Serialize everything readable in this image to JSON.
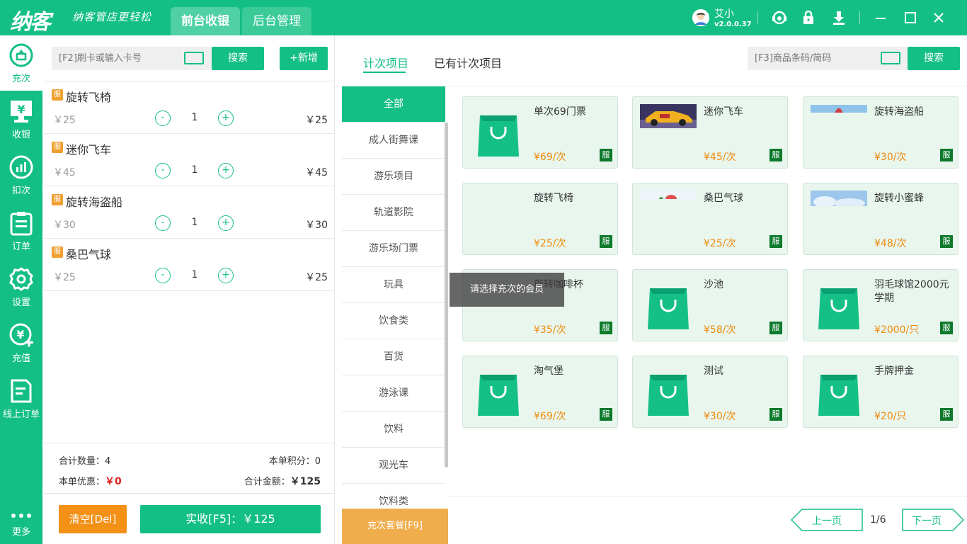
{
  "header": {
    "logo": "纳客",
    "slogan": "纳客管店更轻松",
    "tabs": [
      {
        "label": "前台收银"
      },
      {
        "label": "后台管理"
      }
    ],
    "user_name": "艾小",
    "version": "v2.0.0.37"
  },
  "sidebar": {
    "items": [
      {
        "label": "充次",
        "icon": "recharge-count-icon"
      },
      {
        "label": "收银",
        "icon": "cashier-icon"
      },
      {
        "label": "扣次",
        "icon": "deduct-icon"
      },
      {
        "label": "订单",
        "icon": "order-icon"
      },
      {
        "label": "设置",
        "icon": "gear-icon"
      },
      {
        "label": "充值",
        "icon": "topup-icon"
      },
      {
        "label": "线上订单",
        "icon": "online-order-icon"
      },
      {
        "label": "更多",
        "icon": "more-icon"
      }
    ]
  },
  "left": {
    "card_placeholder": "[F2]刷卡或输入卡号",
    "search_label": "搜索",
    "add_label": "+新增",
    "cart": [
      {
        "badge": "服",
        "name": "旋转飞椅",
        "price": "￥25",
        "qty": "1",
        "total": "￥25"
      },
      {
        "badge": "服",
        "name": "迷你飞车",
        "price": "￥45",
        "qty": "1",
        "total": "￥45"
      },
      {
        "badge": "服",
        "name": "旋转海盗船",
        "price": "￥30",
        "qty": "1",
        "total": "￥30"
      },
      {
        "badge": "服",
        "name": "桑巴气球",
        "price": "￥25",
        "qty": "1",
        "total": "￥25"
      }
    ],
    "minus": "-",
    "plus": "+",
    "summary": {
      "count_label": "合计数量：4",
      "points_label": "本单积分：0",
      "discount_label": "本单优惠：",
      "discount_value": "￥0",
      "total_label": "合计金额：",
      "total_value": "￥125"
    },
    "clear_label": "清空[Del]",
    "pay_label": "实收[F5]：￥125"
  },
  "right": {
    "tabs": [
      {
        "label": "计次项目"
      },
      {
        "label": "已有计次项目"
      }
    ],
    "barcode_placeholder": "[F3]商品条码/简码",
    "search_label": "搜索",
    "categories": [
      "全部",
      "成人街舞课",
      "游乐项目",
      "轨道影院",
      "游乐场门票",
      "玩具",
      "饮食类",
      "百货",
      "游泳课",
      "饮料",
      "观光车",
      "饮料类"
    ],
    "package_label": "充次套餐[F9]",
    "products": [
      {
        "name": "单次69门票",
        "price": "¥69/次",
        "badge": "服",
        "img": "bag"
      },
      {
        "name": "迷你飞车",
        "price": "¥45/次",
        "badge": "服",
        "img": "car"
      },
      {
        "name": "旋转海盗船",
        "price": "¥30/次",
        "badge": "服",
        "img": "sky-strip"
      },
      {
        "name": "旋转飞椅",
        "price": "¥25/次",
        "badge": "服",
        "img": "none"
      },
      {
        "name": "桑巴气球",
        "price": "¥25/次",
        "badge": "服",
        "img": "balloon-strip"
      },
      {
        "name": "旋转小蜜蜂",
        "price": "¥48/次",
        "badge": "服",
        "img": "cloud"
      },
      {
        "name": "旋转咖啡杯",
        "price": "¥35/次",
        "badge": "服",
        "img": "none"
      },
      {
        "name": "沙池",
        "price": "¥58/次",
        "badge": "服",
        "img": "bag"
      },
      {
        "name": "羽毛球馆2000元学期",
        "price": "¥2000/只",
        "badge": "服",
        "img": "bag"
      },
      {
        "name": "淘气堡",
        "price": "¥69/次",
        "badge": "服",
        "img": "bag"
      },
      {
        "name": "测试",
        "price": "¥30/次",
        "badge": "服",
        "img": "bag"
      },
      {
        "name": "手牌押金",
        "price": "¥20/只",
        "badge": "服",
        "img": "bag"
      }
    ],
    "tooltip": "请选择充次的会员",
    "prev_label": "上一页",
    "next_label": "下一页",
    "page": "1/6"
  },
  "colors": {
    "brand": "#14bf86",
    "price": "#f08a0a",
    "clear": "#f39016",
    "package": "#efad4c",
    "badge": "#0d7a2c"
  }
}
